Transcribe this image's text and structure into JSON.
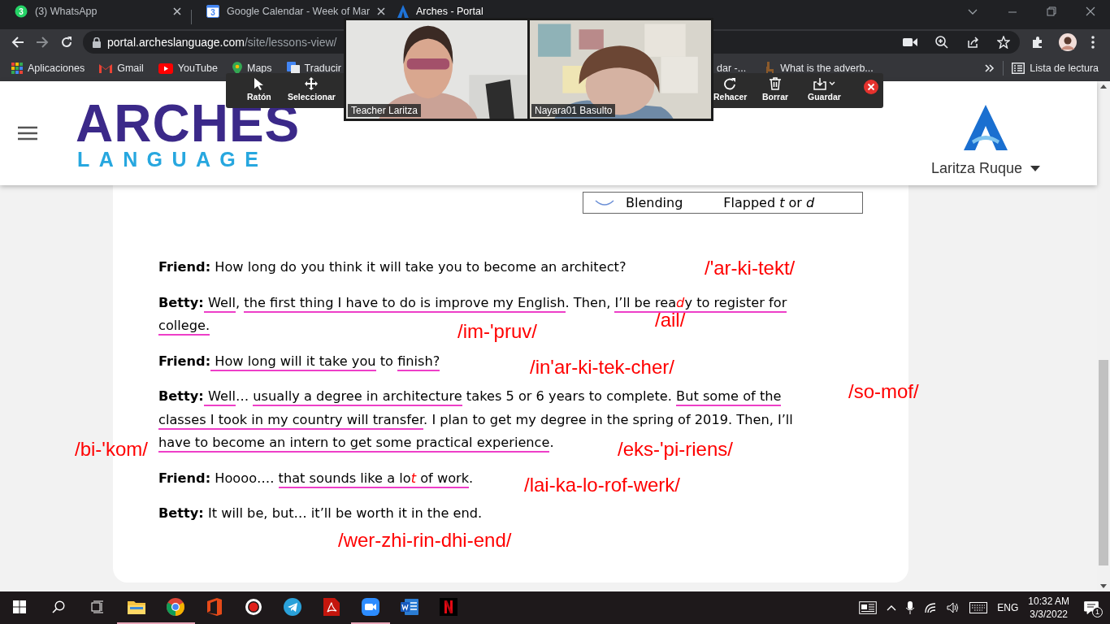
{
  "browser": {
    "tabs": [
      {
        "title": "(3) WhatsApp",
        "icon_text": "3",
        "kind": "whatsapp",
        "selected": false
      },
      {
        "title": "Google Calendar - Week of Mar",
        "icon_text": "3",
        "kind": "calendar",
        "selected": false
      },
      {
        "title": "Arches - Portal",
        "kind": "arches",
        "selected": true
      }
    ],
    "address": {
      "host": "portal.archeslanguage.com",
      "path": "/site/lessons-view/"
    },
    "bookmarks": [
      {
        "label": "Aplicaciones",
        "kind": "apps"
      },
      {
        "label": "Gmail",
        "kind": "gmail"
      },
      {
        "label": "YouTube",
        "kind": "youtube"
      },
      {
        "label": "Maps",
        "kind": "maps"
      },
      {
        "label": "Traducir",
        "kind": "translate"
      },
      {
        "label": "dar -...",
        "kind": "none"
      },
      {
        "label": "What is the adverb...",
        "kind": "page"
      }
    ],
    "reading_list": "Lista de lectura"
  },
  "site": {
    "logo_top": "ARCHES",
    "logo_bottom": "LANGUAGE",
    "user": "Laritza Ruque"
  },
  "legend": {
    "blending": "Blending",
    "flapped": "Flapped *t* or *d*"
  },
  "dialogue": [
    {
      "speaker": "Friend:",
      "segments": [
        {
          "text": " How long do you think it will take you to become an architect?",
          "underlined": false,
          "flapped": false
        }
      ]
    },
    {
      "speaker": "Betty:",
      "segments": [
        {
          "text": " Well",
          "underlined": true,
          "flapped": false
        },
        {
          "text": ", ",
          "underlined": false,
          "flapped": false
        },
        {
          "text": "the first thing I have to do",
          "underlined": true,
          "flapped": false
        },
        {
          "text": " is improve my English",
          "underlined": true,
          "flapped": false
        },
        {
          "text": ". Then, ",
          "underlined": false,
          "flapped": false
        },
        {
          "text": "I’ll be rea",
          "underlined": true,
          "flapped": false
        },
        {
          "text": "d",
          "underlined": true,
          "flapped": true
        },
        {
          "text": "y",
          "underlined": true,
          "flapped": false
        },
        {
          "text": " to register for college.",
          "underlined": true,
          "flapped": false
        }
      ]
    },
    {
      "speaker": "Friend:",
      "segments": [
        {
          "text": " How long",
          "underlined": true,
          "flapped": false
        },
        {
          "text": " will it take you",
          "underlined": true,
          "flapped": false
        },
        {
          "text": " to ",
          "underlined": false,
          "flapped": false
        },
        {
          "text": "finish?",
          "underlined": true,
          "flapped": false
        }
      ]
    },
    {
      "speaker": "Betty:",
      "segments": [
        {
          "text": " Well",
          "underlined": true,
          "flapped": false
        },
        {
          "text": "… ",
          "underlined": false,
          "flapped": false
        },
        {
          "text": "usually a degree in architecture",
          "underlined": true,
          "flapped": false
        },
        {
          "text": " takes 5 or 6 years to complete. ",
          "underlined": false,
          "flapped": false
        },
        {
          "text": "But some of the classes",
          "underlined": true,
          "flapped": false
        },
        {
          "text": " I took in my country",
          "underlined": true,
          "flapped": false
        },
        {
          "text": " will transfer",
          "underlined": true,
          "flapped": false
        },
        {
          "text": ". I plan to get my degree in the spring of 2019. Then, I’ll ",
          "underlined": false,
          "flapped": false
        },
        {
          "text": "have to become",
          "underlined": true,
          "flapped": false
        },
        {
          "text": " an intern",
          "underlined": true,
          "flapped": false
        },
        {
          "text": " to get some practical experience",
          "underlined": true,
          "flapped": false
        },
        {
          "text": ".",
          "underlined": false,
          "flapped": false
        }
      ]
    },
    {
      "speaker": "Friend:",
      "segments": [
        {
          "text": " Hoooo…. ",
          "underlined": false,
          "flapped": false
        },
        {
          "text": "that sounds like a lo",
          "underlined": true,
          "flapped": false
        },
        {
          "text": "t",
          "underlined": true,
          "flapped": true
        },
        {
          "text": " of work",
          "underlined": true,
          "flapped": false
        },
        {
          "text": ".",
          "underlined": false,
          "flapped": false
        }
      ]
    },
    {
      "speaker": "Betty:",
      "segments": [
        {
          "text": " It will be, but… it’ll be worth it in the end.",
          "underlined": false,
          "flapped": false
        }
      ]
    }
  ],
  "annotations": [
    "/'ar-ki-tekt/",
    "/ail/",
    "/im-'pruv/",
    "/in'ar-ki-tek-cher/",
    "/so-mof/",
    "/bi-'kom/",
    "/eks-'pi-riens/",
    "/lai-ka-lo-rof-werk/",
    "/wer-zhi-rin-dhi-end/"
  ],
  "meeting": {
    "participants": [
      {
        "name": "Teacher Laritza"
      },
      {
        "name": "Nayara01 Basulto"
      }
    ],
    "tools": [
      {
        "label": "Ratón",
        "kind": "pointer"
      },
      {
        "label": "Seleccionar",
        "kind": "move"
      },
      {
        "label": "Rehacer",
        "kind": "redo"
      },
      {
        "label": "Borrar",
        "kind": "trash"
      },
      {
        "label": "Guardar",
        "kind": "save"
      }
    ]
  },
  "taskbar": {
    "apps": [
      {
        "kind": "explorer",
        "running": true
      },
      {
        "kind": "chrome",
        "running": true
      },
      {
        "kind": "office",
        "running": false
      },
      {
        "kind": "record",
        "running": false
      },
      {
        "kind": "telegram",
        "running": false
      },
      {
        "kind": "pdf",
        "running": false
      },
      {
        "kind": "zoom",
        "running": true
      },
      {
        "kind": "word",
        "running": false
      },
      {
        "kind": "netflix",
        "running": false
      }
    ],
    "language": "ENG",
    "time": "10:32 AM",
    "date": "3/3/2022",
    "notifications": "1"
  }
}
